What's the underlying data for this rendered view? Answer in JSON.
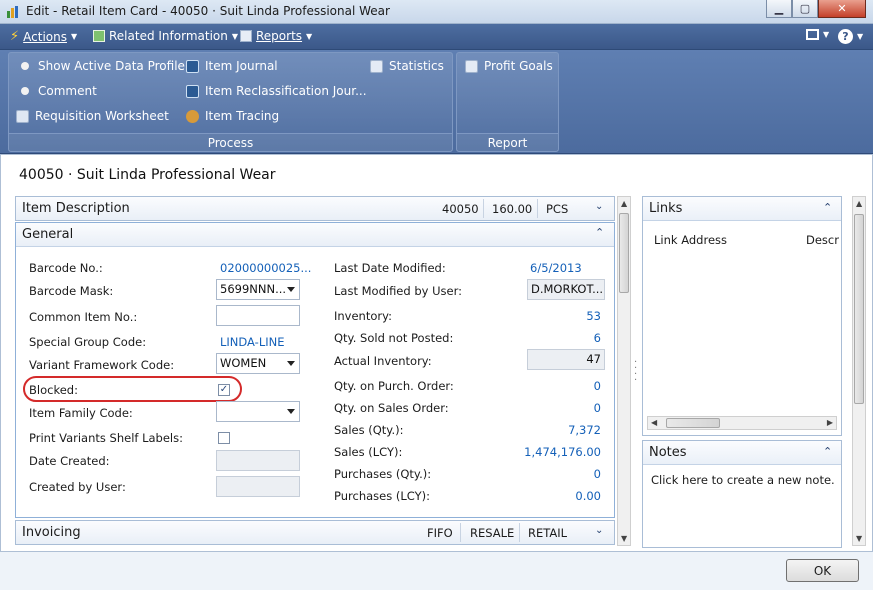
{
  "window": {
    "title": "Edit - Retail Item Card - 40050 · Suit Linda Professional Wear"
  },
  "menubar": {
    "actions": "Actions",
    "related": "Related Information",
    "reports": "Reports"
  },
  "ribbon": {
    "process_items": [
      "Show Active Data Profile",
      "Comment",
      "Requisition Worksheet",
      "Item Journal",
      "Item Reclassification Jour...",
      "Item Tracing",
      "Statistics"
    ],
    "process_label": "Process",
    "report_items": [
      "Profit Goals"
    ],
    "report_label": "Report"
  },
  "page_title": "40050 · Suit Linda Professional Wear",
  "item_description": {
    "title": "Item Description",
    "no": "40050",
    "price": "160.00",
    "unit": "PCS"
  },
  "general": {
    "title": "General",
    "barcode_no": {
      "label": "Barcode No.:",
      "value": "02000000025..."
    },
    "barcode_mask": {
      "label": "Barcode Mask:",
      "value": "5699NNN..."
    },
    "common_item_no": {
      "label": "Common Item No.:",
      "value": ""
    },
    "special_group_code": {
      "label": "Special Group Code:",
      "value": "LINDA-LINE"
    },
    "variant_framework_code": {
      "label": "Variant Framework Code:",
      "value": "WOMEN"
    },
    "blocked": {
      "label": "Blocked:",
      "checked": true
    },
    "item_family_code": {
      "label": "Item Family Code:",
      "value": ""
    },
    "print_variants_shelf_labels": {
      "label": "Print Variants Shelf Labels:",
      "checked": false
    },
    "date_created": {
      "label": "Date Created:",
      "value": ""
    },
    "created_by_user": {
      "label": "Created by User:",
      "value": ""
    },
    "last_date_modified": {
      "label": "Last Date Modified:",
      "value": "6/5/2013"
    },
    "last_modified_by_user": {
      "label": "Last Modified by User:",
      "value": "D.MORKOT..."
    },
    "inventory": {
      "label": "Inventory:",
      "value": "53"
    },
    "qty_sold_not_posted": {
      "label": "Qty. Sold not Posted:",
      "value": "6"
    },
    "actual_inventory": {
      "label": "Actual Inventory:",
      "value": "47"
    },
    "qty_on_purch_order": {
      "label": "Qty. on Purch. Order:",
      "value": "0"
    },
    "qty_on_sales_order": {
      "label": "Qty. on Sales Order:",
      "value": "0"
    },
    "sales_qty": {
      "label": "Sales (Qty.):",
      "value": "7,372"
    },
    "sales_lcy": {
      "label": "Sales (LCY):",
      "value": "1,474,176.00"
    },
    "purchases_qty": {
      "label": "Purchases (Qty.):",
      "value": "0"
    },
    "purchases_lcy": {
      "label": "Purchases (LCY):",
      "value": "0.00"
    }
  },
  "invoicing": {
    "title": "Invoicing",
    "costing": "FIFO",
    "posting_group": "RESALE",
    "vat": "RETAIL"
  },
  "links": {
    "title": "Links",
    "col_link": "Link Address",
    "col_desc": "Descr"
  },
  "notes": {
    "title": "Notes",
    "placeholder": "Click here to create a new note."
  },
  "footer": {
    "ok": "OK"
  },
  "colors": {
    "menubar": "#3f5e91",
    "ribbon": "#5574a8",
    "link_blue": "#1460b8",
    "highlight_red": "#d42a2a"
  }
}
